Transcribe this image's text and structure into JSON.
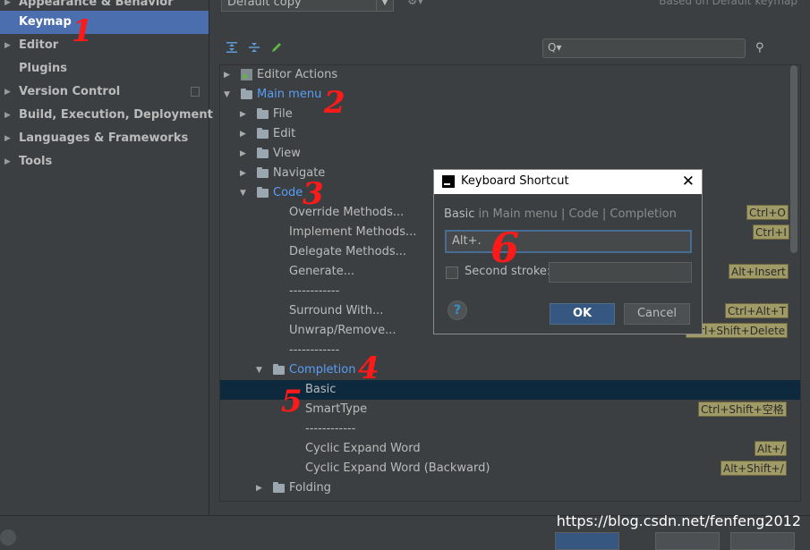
{
  "sidebar": {
    "items": [
      {
        "label": "Appearance & Behavior",
        "arrow": "▶"
      },
      {
        "label": "Keymap",
        "arrow": ""
      },
      {
        "label": "Editor",
        "arrow": "▶"
      },
      {
        "label": "Plugins",
        "arrow": ""
      },
      {
        "label": "Version Control",
        "arrow": "▶"
      },
      {
        "label": "Build, Execution, Deployment",
        "arrow": "▶"
      },
      {
        "label": "Languages & Frameworks",
        "arrow": "▶"
      },
      {
        "label": "Tools",
        "arrow": "▶"
      }
    ],
    "selected": "Keymap"
  },
  "header": {
    "keymap_value": "Default copy",
    "based_on": "Based on Default keymap",
    "dropdown_glyph": "▼",
    "gear_glyph": "⚙▾"
  },
  "toolbar": {
    "search_placeholder": "",
    "search_glyph": "Q▾",
    "find_glyph": "⚲"
  },
  "tree": {
    "rows": [
      {
        "label": "Editor Actions",
        "arrow": "▶",
        "shortcut": ""
      },
      {
        "label": "Main menu",
        "arrow": "▼",
        "shortcut": ""
      },
      {
        "label": "File",
        "arrow": "▶",
        "shortcut": ""
      },
      {
        "label": "Edit",
        "arrow": "▶",
        "shortcut": ""
      },
      {
        "label": "View",
        "arrow": "▶",
        "shortcut": ""
      },
      {
        "label": "Navigate",
        "arrow": "▶",
        "shortcut": ""
      },
      {
        "label": "Code",
        "arrow": "▼",
        "shortcut": ""
      },
      {
        "label": "Override Methods...",
        "arrow": "",
        "shortcut": "Ctrl+O"
      },
      {
        "label": "Implement Methods...",
        "arrow": "",
        "shortcut": "Ctrl+I"
      },
      {
        "label": "Delegate Methods...",
        "arrow": "",
        "shortcut": ""
      },
      {
        "label": "Generate...",
        "arrow": "",
        "shortcut": "Alt+Insert"
      },
      {
        "label": "------------",
        "arrow": "",
        "shortcut": ""
      },
      {
        "label": "Surround With...",
        "arrow": "",
        "shortcut": "Ctrl+Alt+T"
      },
      {
        "label": "Unwrap/Remove...",
        "arrow": "",
        "shortcut": "Ctrl+Shift+Delete"
      },
      {
        "label": "------------",
        "arrow": "",
        "shortcut": ""
      },
      {
        "label": "Completion",
        "arrow": "▼",
        "shortcut": ""
      },
      {
        "label": "Basic",
        "arrow": "",
        "shortcut": ""
      },
      {
        "label": "SmartType",
        "arrow": "",
        "shortcut": "Ctrl+Shift+空格"
      },
      {
        "label": "------------",
        "arrow": "",
        "shortcut": ""
      },
      {
        "label": "Cyclic Expand Word",
        "arrow": "",
        "shortcut": "Alt+/"
      },
      {
        "label": "Cyclic Expand Word (Backward)",
        "arrow": "",
        "shortcut": "Alt+Shift+/"
      },
      {
        "label": "Folding",
        "arrow": "▶",
        "shortcut": ""
      }
    ]
  },
  "dialog": {
    "title": "Keyboard Shortcut",
    "close_glyph": "✕",
    "path_action": "Basic",
    "path_in": " in Main menu | Code | Completion",
    "first_stroke_value": "Alt+.",
    "second_stroke_label": "Second stroke:",
    "second_stroke_value": "",
    "help_glyph": "?",
    "ok_label": "OK",
    "cancel_label": "Cancel"
  },
  "watermark": "https://blog.csdn.net/fenfeng2012",
  "annotations": [
    "1",
    "2",
    "3",
    "4",
    "5",
    "6"
  ],
  "colors": {
    "background": "#3c3f41",
    "selection": "#4b6eaf",
    "tree_selection": "#0d293e",
    "link_blue": "#589df6",
    "shortcut_badge": "#a09a66",
    "annotation_red": "#ff1a1a"
  }
}
